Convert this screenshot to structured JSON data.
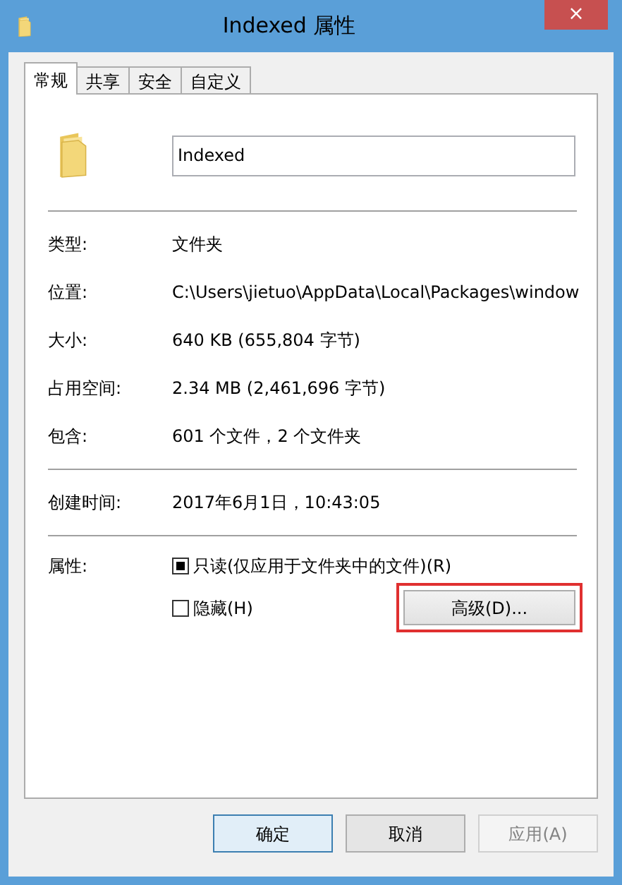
{
  "window": {
    "title": "Indexed 属性",
    "close_glyph": "×"
  },
  "tabs": [
    {
      "label": "常规",
      "selected": true
    },
    {
      "label": "共享",
      "selected": false
    },
    {
      "label": "安全",
      "selected": false
    },
    {
      "label": "自定义",
      "selected": false
    }
  ],
  "name_field": {
    "value": "Indexed"
  },
  "groups": [
    [
      {
        "label": "类型:",
        "value": "文件夹"
      },
      {
        "label": "位置:",
        "value": "C:\\Users\\jietuo\\AppData\\Local\\Packages\\window"
      },
      {
        "label": "大小:",
        "value": "640 KB (655,804 字节)"
      },
      {
        "label": "占用空间:",
        "value": "2.34 MB (2,461,696 字节)"
      },
      {
        "label": "包含:",
        "value": "601 个文件，2 个文件夹"
      }
    ],
    [
      {
        "label": "创建时间:",
        "value": "2017年6月1日，10:43:05"
      }
    ]
  ],
  "attributes": {
    "label": "属性:",
    "checkboxes": [
      {
        "label": "只读(仅应用于文件夹中的文件)(R)",
        "indeterminate": true
      },
      {
        "label": "隐藏(H)",
        "indeterminate": false
      }
    ],
    "advanced_button": {
      "label": "高级(D)...",
      "highlighted": true
    }
  },
  "buttons": [
    {
      "label": "确定",
      "default": true,
      "disabled": false
    },
    {
      "label": "取消",
      "default": false,
      "disabled": false
    },
    {
      "label": "应用(A)",
      "default": false,
      "disabled": true
    }
  ]
}
